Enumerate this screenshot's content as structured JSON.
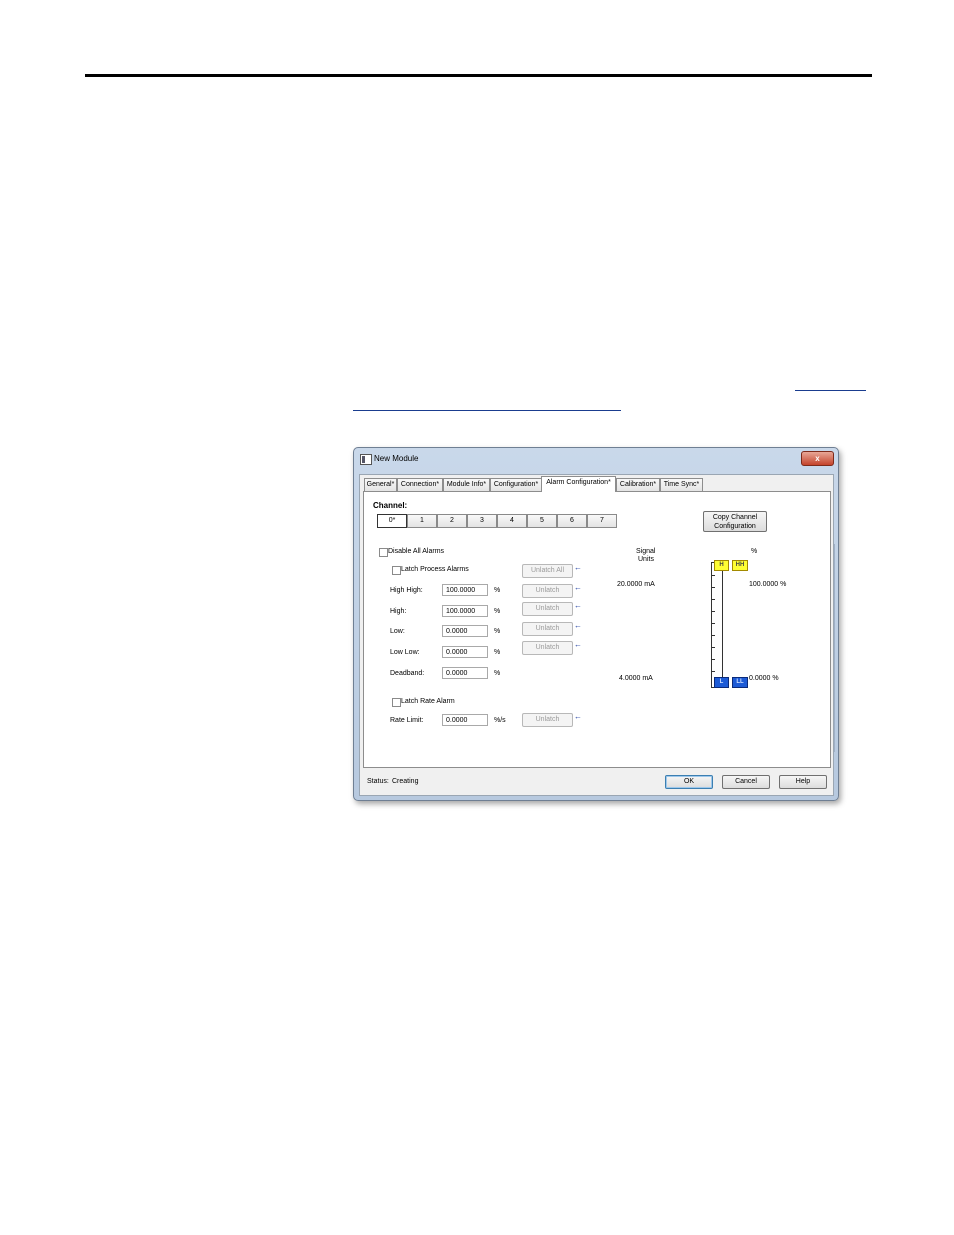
{
  "window": {
    "title": "New Module",
    "close_glyph": "x"
  },
  "tabs": [
    {
      "label": "General*"
    },
    {
      "label": "Connection*"
    },
    {
      "label": "Module Info*"
    },
    {
      "label": "Configuration*"
    },
    {
      "label": "Alarm Configuration*"
    },
    {
      "label": "Calibration*"
    },
    {
      "label": "Time Sync*"
    }
  ],
  "active_tab": "Alarm Configuration*",
  "channel": {
    "label": "Channel:",
    "buttons": [
      "0*",
      "1",
      "2",
      "3",
      "4",
      "5",
      "6",
      "7"
    ],
    "selected": "0*"
  },
  "copy_button": {
    "line1": "Copy Channel",
    "line2": "Configuration"
  },
  "options": {
    "disable_all_alarms": "Disable All Alarms",
    "latch_process_alarms": "Latch Process Alarms",
    "latch_rate_alarm": "Latch Rate Alarm"
  },
  "fields": {
    "high_high": {
      "label": "High High:",
      "value": "100.0000",
      "unit": "%"
    },
    "high": {
      "label": "High:",
      "value": "100.0000",
      "unit": "%"
    },
    "low": {
      "label": "Low:",
      "value": "0.0000",
      "unit": "%"
    },
    "low_low": {
      "label": "Low Low:",
      "value": "0.0000",
      "unit": "%"
    },
    "deadband": {
      "label": "Deadband:",
      "value": "0.0000",
      "unit": "%"
    },
    "rate_limit": {
      "label": "Rate Limit:",
      "value": "0.0000",
      "unit": "%/s"
    }
  },
  "unlatch": {
    "all": "Unlatch All",
    "single": "Unlatch"
  },
  "scale": {
    "signal_units_line1": "Signal",
    "signal_units_line2": "Units",
    "percent_header": "%",
    "signal_high": "20.0000 mA",
    "signal_low": "4.0000 mA",
    "percent_high": "100.0000 %",
    "percent_low": "0.0000 %",
    "flags": {
      "h": "H",
      "hh": "HH",
      "l": "L",
      "ll": "LL"
    },
    "colors": {
      "high_flags": "#ffff33",
      "low_flags": "#1d5bd6"
    }
  },
  "status": {
    "label": "Status:",
    "value": "Creating"
  },
  "footer": {
    "ok": "OK",
    "cancel": "Cancel",
    "help": "Help"
  }
}
